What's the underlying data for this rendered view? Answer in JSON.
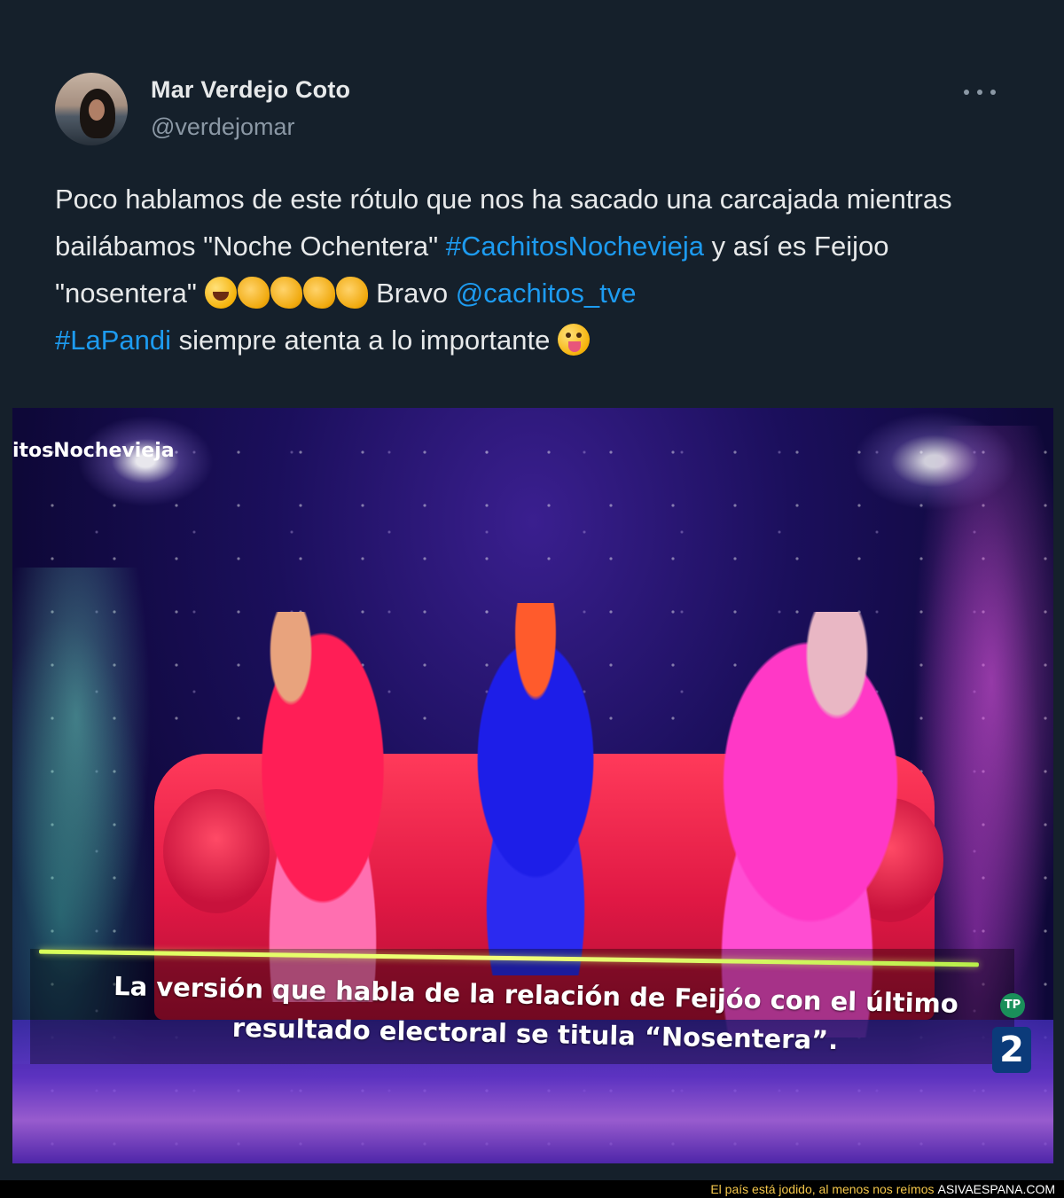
{
  "tweet": {
    "author_name": "Mar Verdejo Coto",
    "author_handle": "@verdejomar",
    "text": {
      "p1": "Poco hablamos de este rótulo que nos ha sacado una carcajada mientras bailábamos \"Noche Ochentera\" ",
      "hashtag1": "#CachitosNochevieja",
      "p2": " y así es Feijoo \"nosentera\" ",
      "p3": " Bravo ",
      "mention1": "@cachitos_tve",
      "hashtag2": "#LaPandi",
      "p4": " siempre atenta a lo importante "
    },
    "emojis": [
      "rolling-on-floor-laughing-emoji",
      "clapping-hands-emoji",
      "clapping-hands-emoji",
      "clapping-hands-emoji",
      "clapping-hands-emoji",
      "winking-face-tongue-emoji"
    ],
    "colors": {
      "background": "#15202b",
      "link": "#1d9bf0",
      "secondary": "#8b98a5"
    }
  },
  "photo": {
    "hashtag_overlay": "itosNochevieja",
    "caption": "La versión que habla de la relación de Feijóo con el último resultado electoral se titula “Nosentera”.",
    "channel_tag": "TP",
    "channel_number": "2"
  },
  "footer": {
    "slogan": "El país está jodido, al menos nos reímos",
    "site": "ASIVAESPANA.COM"
  }
}
